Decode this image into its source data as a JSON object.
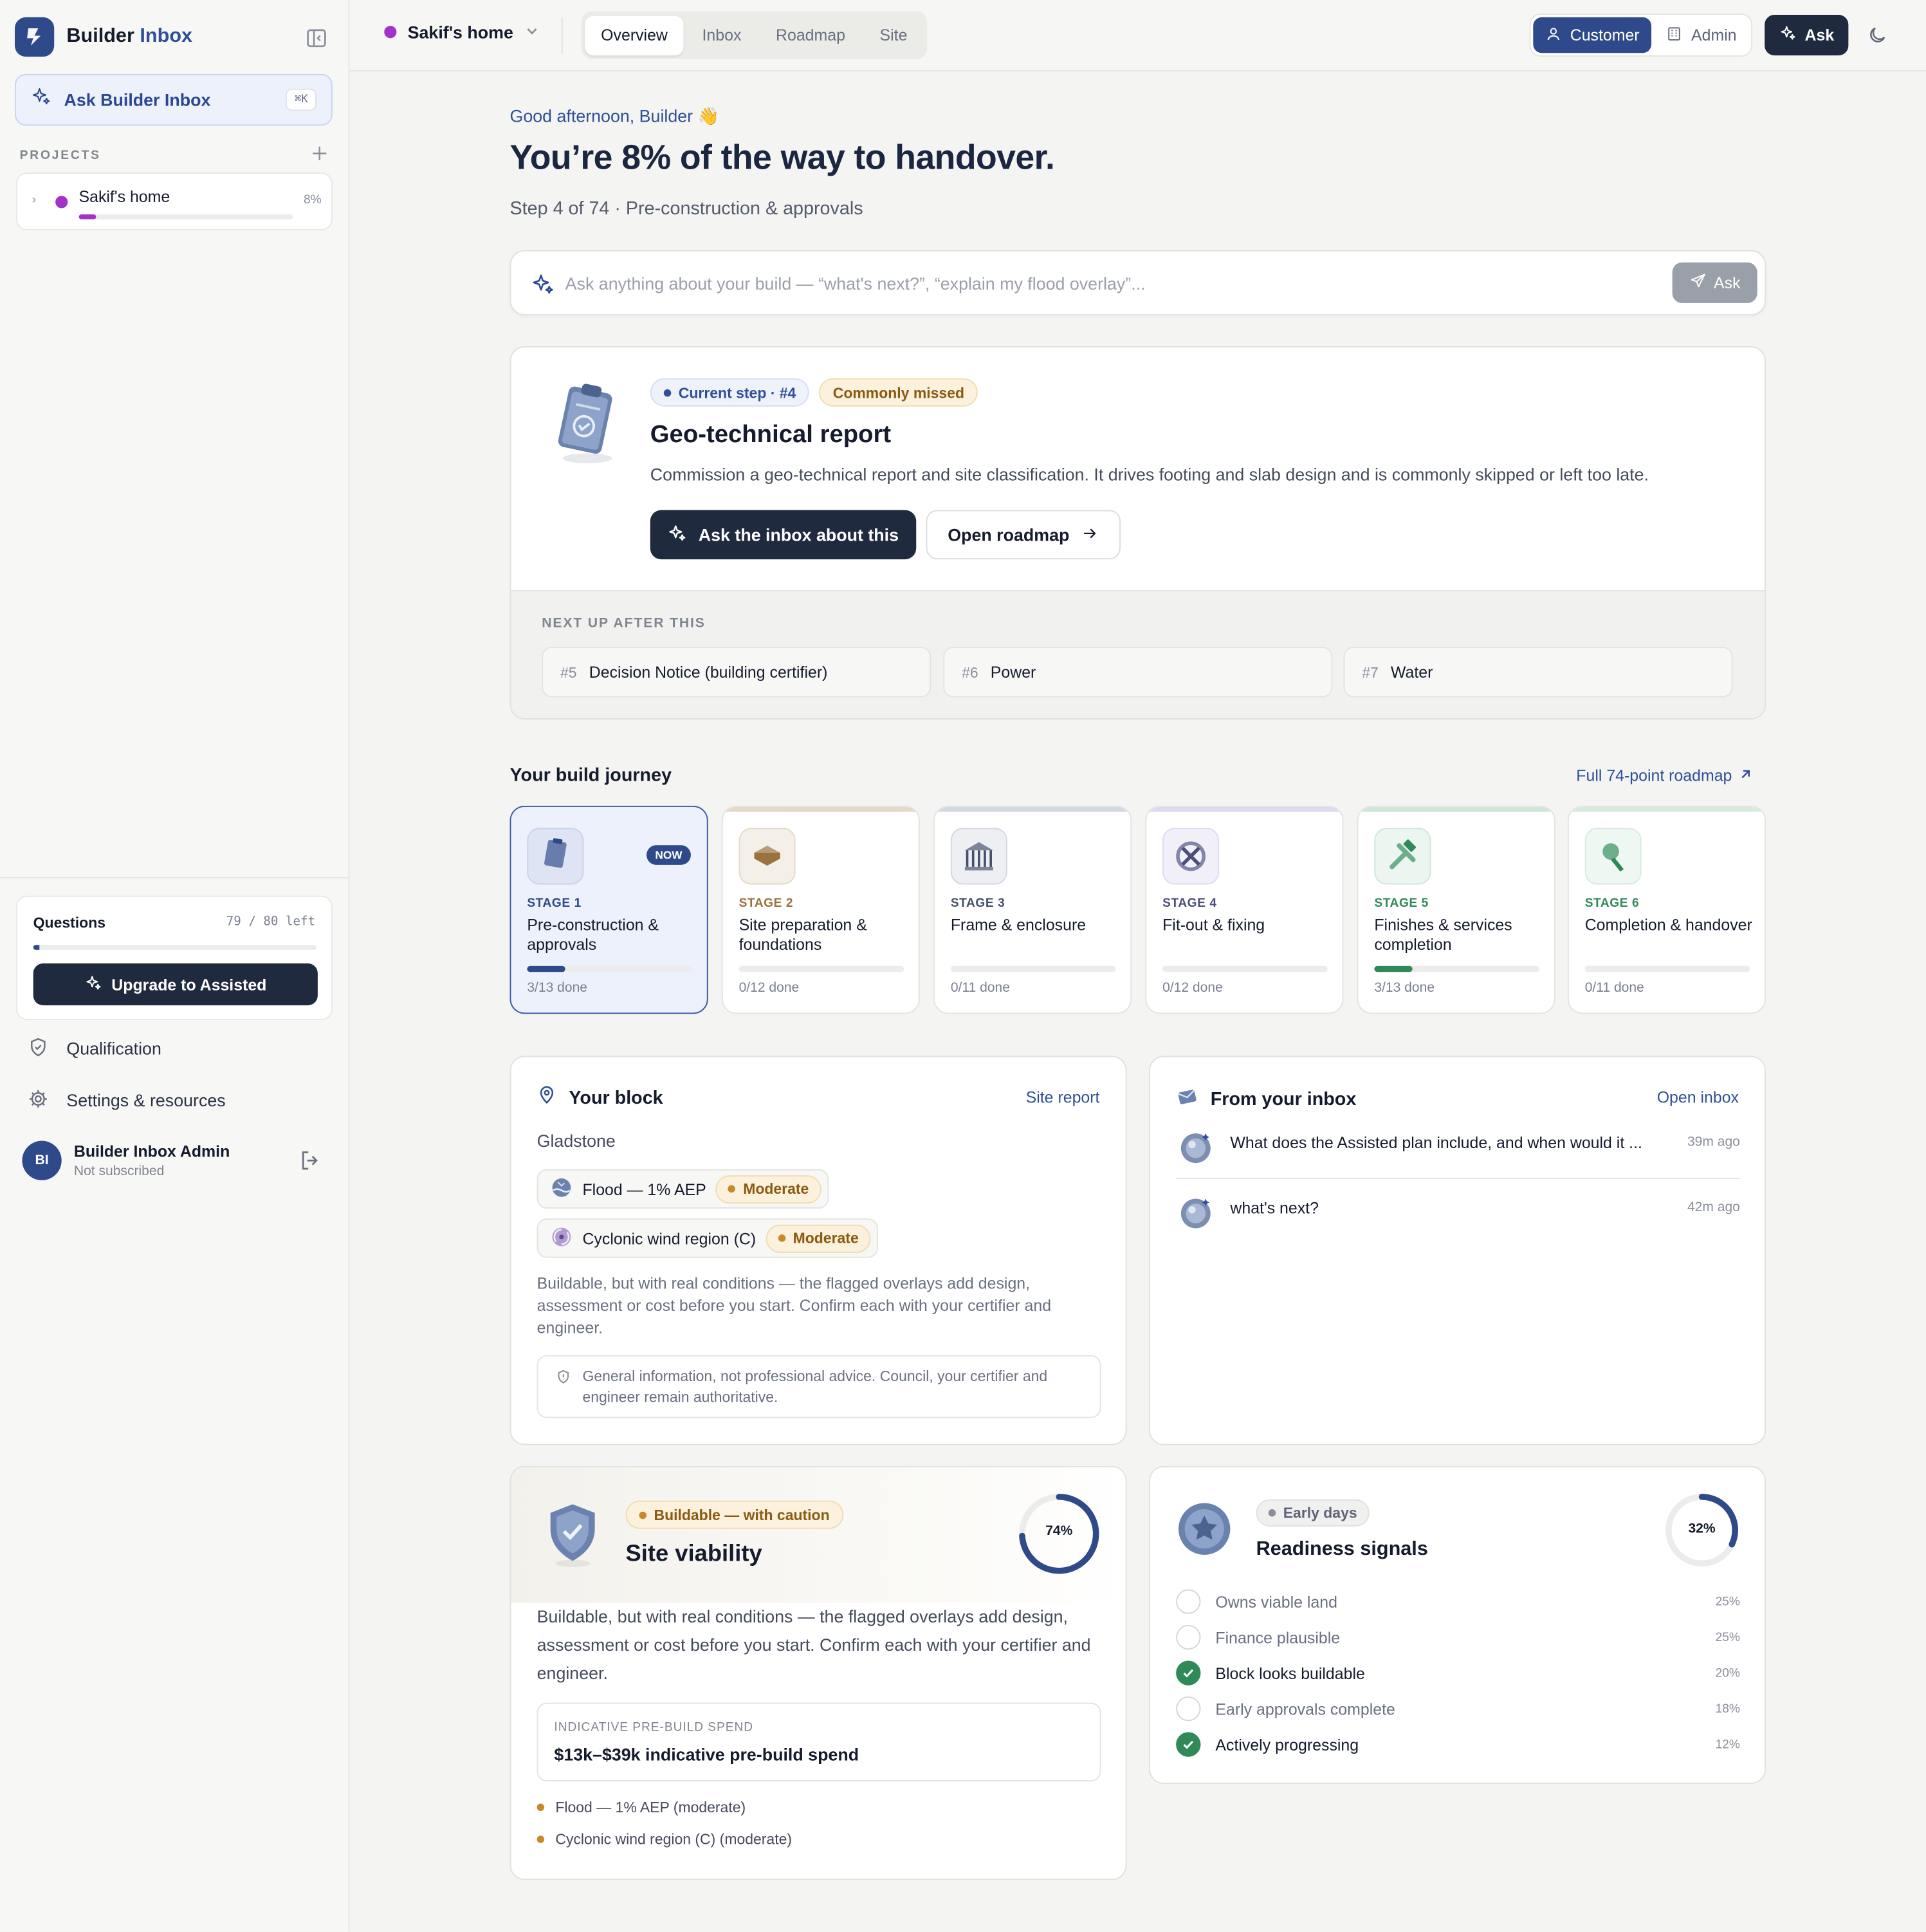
{
  "sidebar": {
    "brand_primary": "Builder",
    "brand_accent": "Inbox",
    "ask_label": "Ask Builder Inbox",
    "ask_shortcut": "⌘K",
    "projects_heading": "PROJECTS",
    "project": {
      "name": "Sakif's home",
      "percent": "8%",
      "progress": 0.08
    },
    "questions": {
      "title": "Questions",
      "count": "79 / 80 left",
      "used_fraction": 0.0125,
      "upgrade_label": "Upgrade to Assisted"
    },
    "links": [
      "Qualification",
      "Settings & resources"
    ],
    "user": {
      "initials": "BI",
      "name": "Builder Inbox Admin",
      "status": "Not subscribed"
    }
  },
  "topbar": {
    "project_name": "Sakif's home",
    "tabs": [
      "Overview",
      "Inbox",
      "Roadmap",
      "Site"
    ],
    "active_tab": "Overview",
    "roles": [
      "Customer",
      "Admin"
    ],
    "active_role": "Customer",
    "ask_label": "Ask"
  },
  "hero": {
    "greeting": "Good afternoon, Builder 👋",
    "headline": "You’re 8% of the way to handover.",
    "subline": "Step 4 of 74 · Pre-construction & approvals",
    "search_placeholder": "Ask anything about your build — “what's next?”, “explain my flood overlay”...",
    "search_button": "Ask"
  },
  "current_step": {
    "badge_current": "Current step · #4",
    "badge_missed": "Commonly missed",
    "title": "Geo-technical report",
    "description": "Commission a geo-technical report and site classification. It drives footing and slab design and is commonly skipped or left too late.",
    "primary_button": "Ask the inbox about this",
    "secondary_button": "Open roadmap",
    "next_heading": "NEXT UP AFTER THIS",
    "next_items": [
      {
        "num": "#5",
        "label": "Decision Notice (building certifier)"
      },
      {
        "num": "#6",
        "label": "Power"
      },
      {
        "num": "#7",
        "label": "Water"
      }
    ]
  },
  "journey": {
    "heading": "Your build journey",
    "link": "Full 74-point roadmap",
    "now_label": "NOW",
    "stages": [
      {
        "label": "STAGE 1",
        "name": "Pre-construction & approvals",
        "done": "3/13 done",
        "progress": 0.23,
        "color": "#2e4a8a",
        "tint": "#c9d3ea"
      },
      {
        "label": "STAGE 2",
        "name": "Site preparation & foundations",
        "done": "0/12 done",
        "progress": 0,
        "color": "#9a7240",
        "tint": "#e4d9c9"
      },
      {
        "label": "STAGE 3",
        "name": "Frame & enclosure",
        "done": "0/11 done",
        "progress": 0,
        "color": "#46506a",
        "tint": "#d3d8e2"
      },
      {
        "label": "STAGE 4",
        "name": "Fit-out & fixing",
        "done": "0/12 done",
        "progress": 0,
        "color": "#4c4f7c",
        "tint": "#dcdaef"
      },
      {
        "label": "STAGE 5",
        "name": "Finishes & services completion",
        "done": "3/13 done",
        "progress": 0.23,
        "color": "#2f8a57",
        "tint": "#cfe7d8"
      },
      {
        "label": "STAGE 6",
        "name": "Completion & handover",
        "done": "0/11 done",
        "progress": 0,
        "color": "#2f8a57",
        "tint": "#d7ebdf"
      }
    ]
  },
  "block": {
    "heading": "Your block",
    "link": "Site report",
    "suburb": "Gladstone",
    "overlays": [
      {
        "name": "Flood — 1% AEP",
        "level": "Moderate"
      },
      {
        "name": "Cyclonic wind region (C)",
        "level": "Moderate"
      }
    ],
    "summary": "Buildable, but with real conditions — the flagged overlays add design, assessment or cost before you start. Confirm each with your certifier and engineer.",
    "disclaimer": "General information, not professional advice. Council, your certifier and engineer remain authoritative."
  },
  "inbox": {
    "heading": "From your inbox",
    "link": "Open inbox",
    "messages": [
      {
        "text": "What does the Assisted plan include, and when would it ...",
        "time": "39m ago"
      },
      {
        "text": "what's next?",
        "time": "42m ago"
      }
    ]
  },
  "viability": {
    "badge": "Buildable — with caution",
    "title": "Site viability",
    "percent_label": "74%",
    "percent": 74,
    "summary": "Buildable, but with real conditions — the flagged overlays add design, assessment or cost before you start. Confirm each with your certifier and engineer.",
    "spend_label": "INDICATIVE PRE-BUILD SPEND",
    "spend_value": "$13k–$39k indicative pre-build spend",
    "items": [
      "Flood — 1% AEP (moderate)",
      "Cyclonic wind region (C) (moderate)"
    ]
  },
  "readiness": {
    "badge": "Early days",
    "title": "Readiness signals",
    "percent_label": "32%",
    "percent": 32,
    "signals": [
      {
        "label": "Owns viable land",
        "pct": "25%",
        "done": false
      },
      {
        "label": "Finance plausible",
        "pct": "25%",
        "done": false
      },
      {
        "label": "Block looks buildable",
        "pct": "20%",
        "done": true
      },
      {
        "label": "Early approvals complete",
        "pct": "18%",
        "done": false
      },
      {
        "label": "Actively progressing",
        "pct": "12%",
        "done": true
      }
    ]
  },
  "colors": {
    "brand": "#2e4a8a",
    "dark": "#1f2a3e",
    "accent_purple": "#a232c9",
    "success": "#2f8a57",
    "warning": "#c68a2a"
  }
}
